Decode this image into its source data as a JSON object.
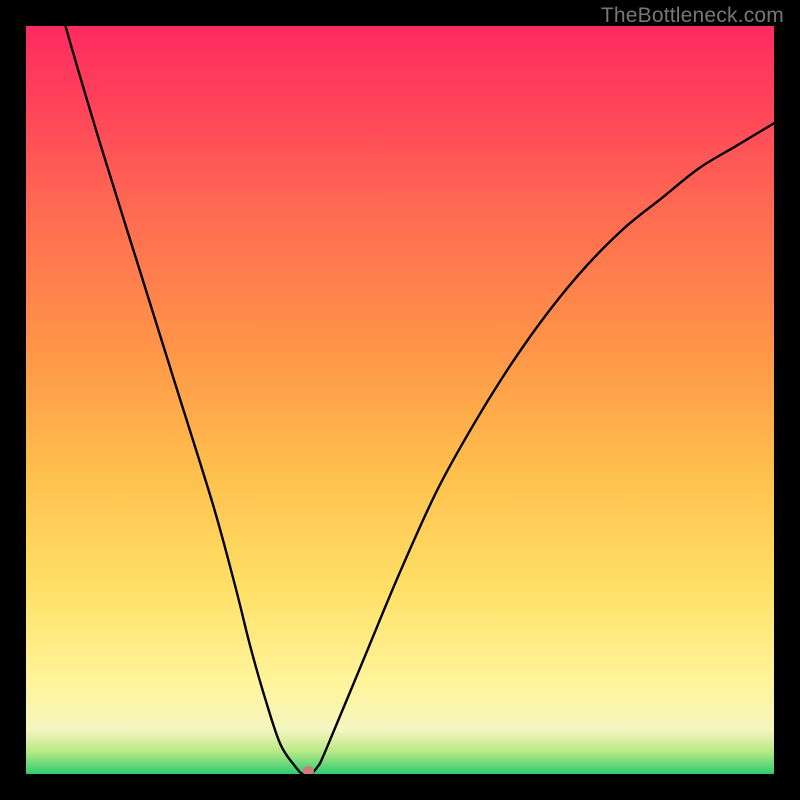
{
  "watermark": "TheBottleneck.com",
  "chart_data": {
    "type": "line",
    "title": "",
    "xlabel": "",
    "ylabel": "",
    "xlim": [
      0,
      100
    ],
    "ylim": [
      0,
      100
    ],
    "series": [
      {
        "name": "bottleneck-curve",
        "x": [
          0,
          5,
          10,
          15,
          20,
          25,
          28,
          30,
          32,
          34,
          36,
          37,
          38,
          39,
          40,
          45,
          50,
          55,
          60,
          65,
          70,
          75,
          80,
          85,
          90,
          95,
          100
        ],
        "values": [
          120,
          101,
          84,
          68,
          52,
          36,
          25,
          17,
          10,
          4,
          1,
          0,
          0,
          1,
          3,
          15,
          27,
          38,
          47,
          55,
          62,
          68,
          73,
          77,
          81,
          84,
          87
        ]
      },
      {
        "name": "min-marker",
        "x": [
          37,
          38.5
        ],
        "values": [
          0,
          0
        ]
      }
    ],
    "gradient_stops": [
      {
        "offset": 0,
        "color": "#2ecc71"
      },
      {
        "offset": 0.03,
        "color": "#b8e986"
      },
      {
        "offset": 0.06,
        "color": "#f5f5c0"
      },
      {
        "offset": 0.118,
        "color": "#fff59d"
      },
      {
        "offset": 0.25,
        "color": "#ffe066"
      },
      {
        "offset": 0.4,
        "color": "#ffc04d"
      },
      {
        "offset": 0.58,
        "color": "#ff9248"
      },
      {
        "offset": 0.75,
        "color": "#ff6b52"
      },
      {
        "offset": 0.9,
        "color": "#ff425a"
      },
      {
        "offset": 1.0,
        "color": "#ff2a60"
      }
    ],
    "marker_color": "#d07a7a"
  }
}
